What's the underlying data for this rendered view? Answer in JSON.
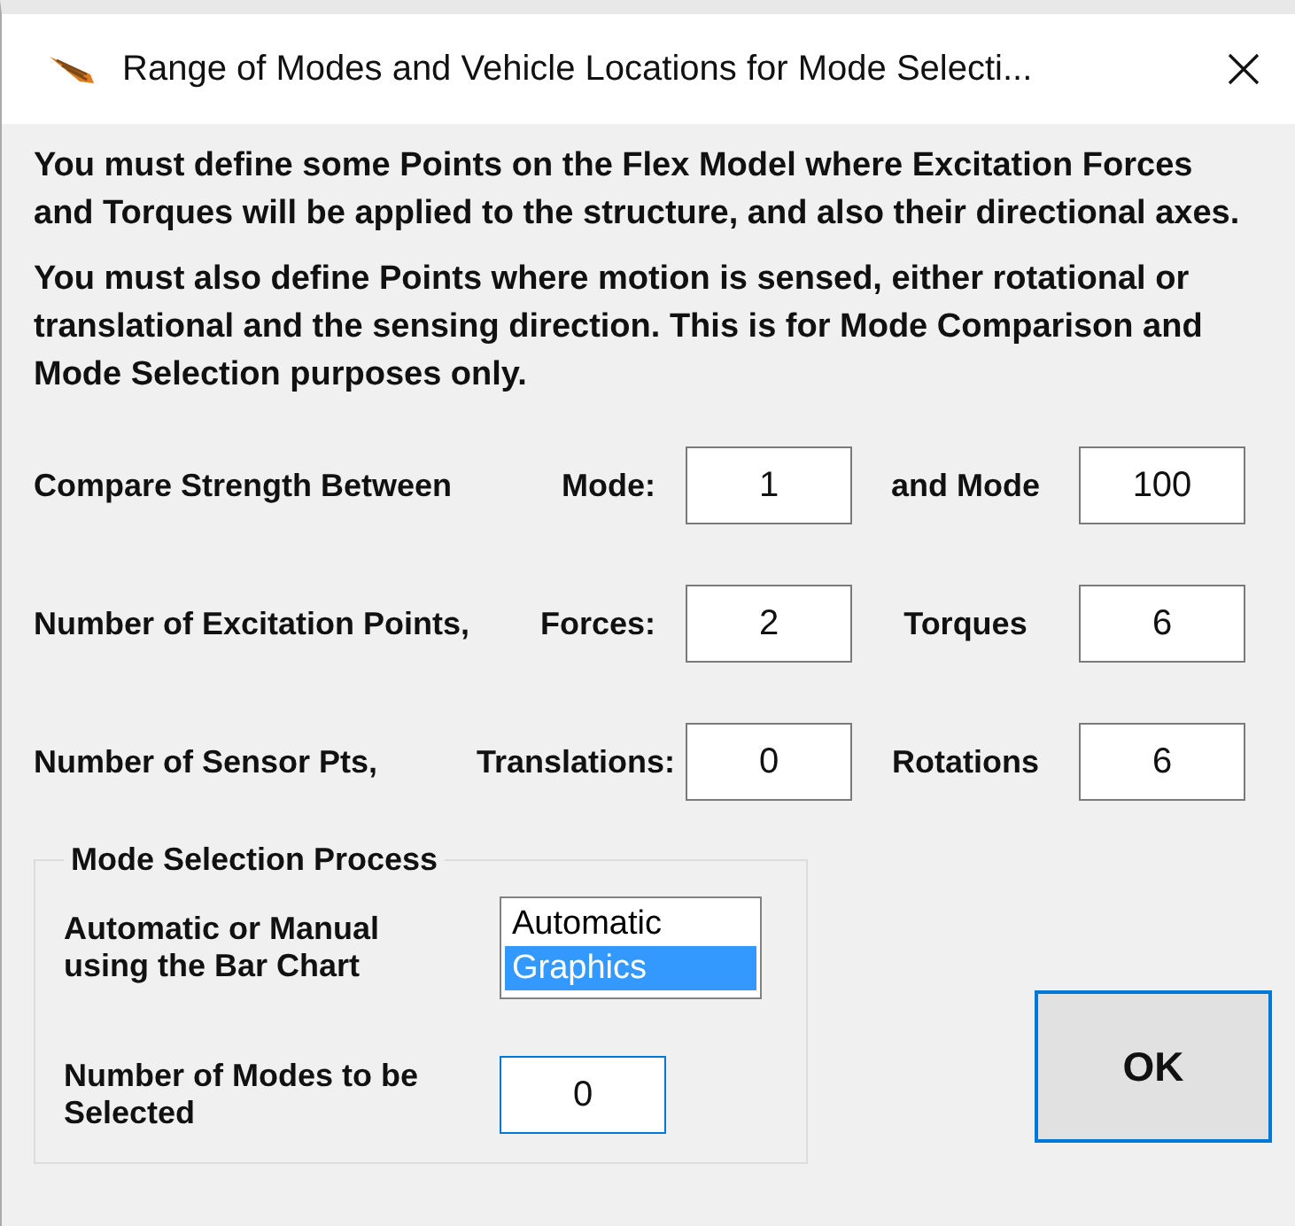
{
  "window": {
    "title": "Range of Modes and Vehicle Locations for Mode Selecti..."
  },
  "instructions": [
    "You must define some Points on the Flex Model where Excitation Forces and Torques will be applied to the structure, and also their directional axes.",
    "You must also define Points where motion is sensed, either rotational or translational and the sensing direction. This is for Mode Comparison and Mode Selection purposes only."
  ],
  "rows": [
    {
      "label": "Compare Strength Between",
      "first_label": "Mode:",
      "first_value": "1",
      "second_label": "and Mode",
      "second_value": "100"
    },
    {
      "label": "Number of Excitation Points,",
      "first_label": "Forces:",
      "first_value": "2",
      "second_label": "Torques",
      "second_value": "6"
    },
    {
      "label": "Number of Sensor Pts,",
      "first_label": "Translations:",
      "first_value": "0",
      "second_label": "Rotations",
      "second_value": "6"
    }
  ],
  "mode_selection": {
    "title": "Mode Selection Process",
    "method_label": "Automatic or Manual using the Bar Chart",
    "options": [
      {
        "label": "Automatic",
        "selected": false
      },
      {
        "label": "Graphics",
        "selected": true
      }
    ],
    "count_label": "Number of Modes to be Selected",
    "count_value": "0"
  },
  "ok_button": "OK"
}
